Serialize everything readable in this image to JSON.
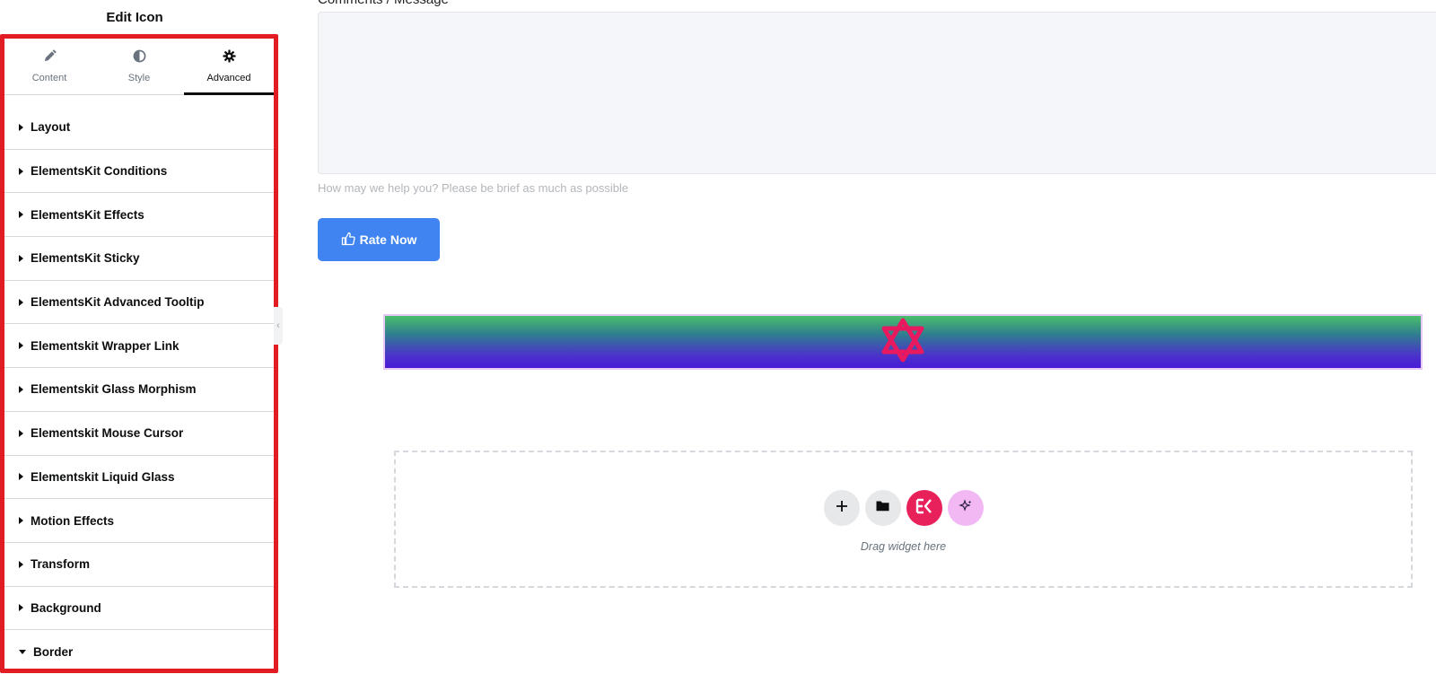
{
  "panel": {
    "title": "Edit Icon",
    "tabs": [
      {
        "label": "Content",
        "icon": "pencil-icon",
        "active": false
      },
      {
        "label": "Style",
        "icon": "half-circle-icon",
        "active": false
      },
      {
        "label": "Advanced",
        "icon": "gear-icon",
        "active": true
      }
    ],
    "sections": [
      {
        "label": "Layout",
        "expanded": false
      },
      {
        "label": "ElementsKit Conditions",
        "expanded": false
      },
      {
        "label": "ElementsKit Effects",
        "expanded": false
      },
      {
        "label": "ElementsKit Sticky",
        "expanded": false
      },
      {
        "label": "ElementsKit Advanced Tooltip",
        "expanded": false
      },
      {
        "label": "Elementskit Wrapper Link",
        "expanded": false
      },
      {
        "label": "Elementskit Glass Morphism",
        "expanded": false
      },
      {
        "label": "Elementskit Mouse Cursor",
        "expanded": false
      },
      {
        "label": "Elementskit Liquid Glass",
        "expanded": false
      },
      {
        "label": "Motion Effects",
        "expanded": false
      },
      {
        "label": "Transform",
        "expanded": false
      },
      {
        "label": "Background",
        "expanded": false
      },
      {
        "label": "Border",
        "expanded": true
      }
    ],
    "frame_color": "#e11d23"
  },
  "canvas": {
    "form": {
      "comments_label": "Comments / Message",
      "help_text": "How may we help you? Please be brief as much as possible",
      "rate_button_label": "Rate Now",
      "rate_button_color": "#3f84f0"
    },
    "icon_widget": {
      "icon": "star-of-david-icon",
      "icon_color": "#e8195f",
      "gradient_top": "#4bbf6a",
      "gradient_bottom": "#4a1bd6"
    },
    "dropzone": {
      "text": "Drag widget here",
      "buttons": [
        "add-icon",
        "folder-icon",
        "elementskit-logo-icon",
        "ai-sparkle-icon"
      ]
    }
  }
}
